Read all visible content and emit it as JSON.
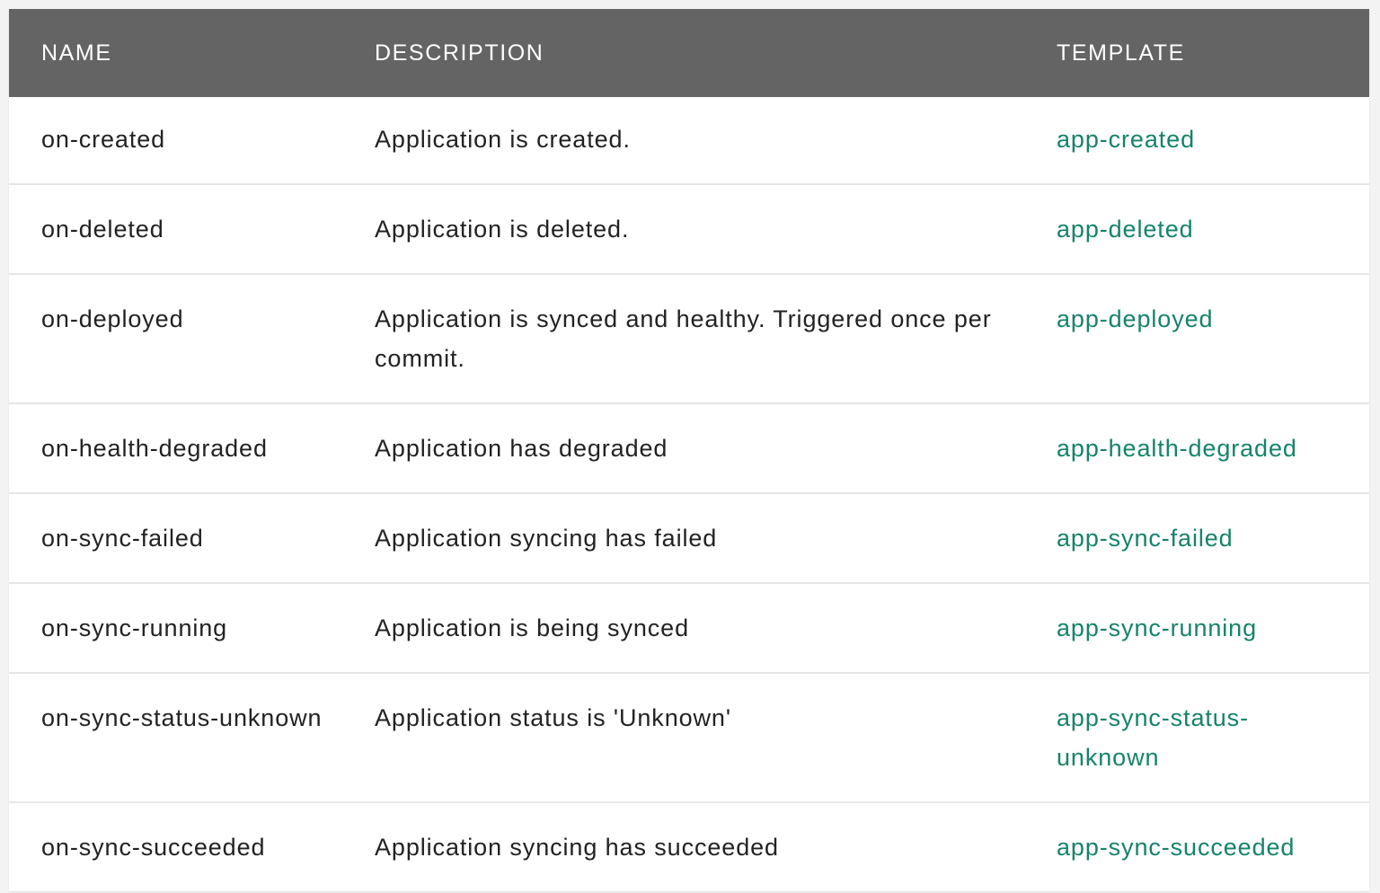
{
  "table": {
    "headers": {
      "name": "NAME",
      "description": "DESCRIPTION",
      "template": "TEMPLATE"
    },
    "rows": [
      {
        "name": "on-created",
        "description": "Application is created.",
        "template": "app-created"
      },
      {
        "name": "on-deleted",
        "description": "Application is deleted.",
        "template": "app-deleted"
      },
      {
        "name": "on-deployed",
        "description": "Application is synced and healthy. Triggered once per commit.",
        "template": "app-deployed"
      },
      {
        "name": "on-health-degraded",
        "description": "Application has degraded",
        "template": "app-health-degraded"
      },
      {
        "name": "on-sync-failed",
        "description": "Application syncing has failed",
        "template": "app-sync-failed"
      },
      {
        "name": "on-sync-running",
        "description": "Application is being synced",
        "template": "app-sync-running"
      },
      {
        "name": "on-sync-status-unknown",
        "description": "Application status is 'Unknown'",
        "template": "app-sync-status-unknown"
      },
      {
        "name": "on-sync-succeeded",
        "description": "Application syncing has succeeded",
        "template": "app-sync-succeeded"
      }
    ]
  },
  "colors": {
    "header_background": "#646464",
    "header_text": "#ffffff",
    "link": "#16836a",
    "row_divider": "#e6e6e6"
  }
}
